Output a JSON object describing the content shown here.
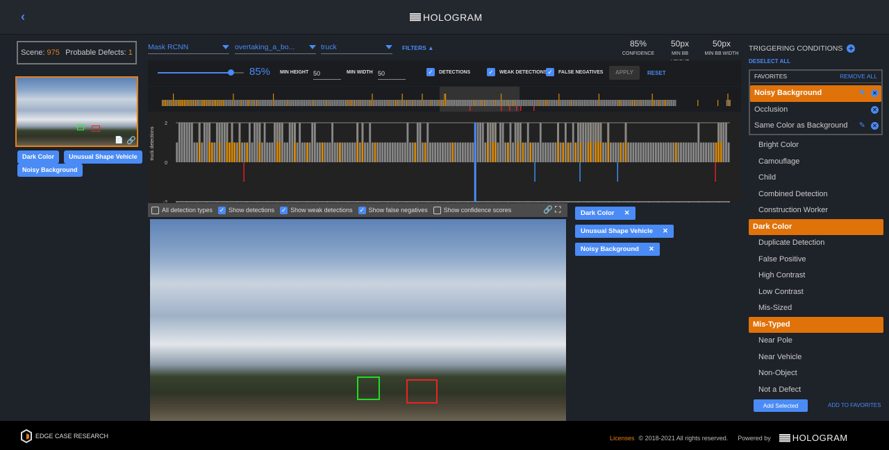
{
  "header": {
    "title": "HOLOGRAM",
    "back_icon": "chevron-left-icon"
  },
  "scene": {
    "label": "Scene:",
    "value": "975",
    "defects_label": "Probable Defects:",
    "defects_value": "1"
  },
  "thumbnail_tags": [
    "Dark Color",
    "Unusual Shape Vehicle",
    "Noisy Background"
  ],
  "dropdowns": {
    "model": "Mask RCNN",
    "scenario": "overtaking_a_bo...",
    "class": "truck",
    "filters_label": "FILTERS"
  },
  "stats": [
    {
      "value": "85%",
      "label": "CONFIDENCE"
    },
    {
      "value": "50px",
      "label": "MIN BB HEIGHT"
    },
    {
      "value": "50px",
      "label": "MIN BB WIDTH"
    }
  ],
  "filters": {
    "confidence_value": "85%",
    "confidence_fraction": 0.85,
    "min_height_label": "MIN HEIGHT",
    "min_height": "50",
    "min_width_label": "MIN WIDTH",
    "min_width": "50",
    "detections": "DETECTIONS",
    "weak": "WEAK DETECTIONS",
    "false_neg": "FALSE NEGATIVES",
    "apply": "APPLY",
    "reset": "RESET"
  },
  "minimap": {
    "range_start": "856",
    "range_end": "1077"
  },
  "chart_data": {
    "type": "bar",
    "ylabel": "truck detections",
    "ylim": [
      -2,
      2
    ],
    "yticks": [
      "2",
      "0",
      "-2"
    ],
    "x_start": 856,
    "x_end": 1076,
    "tick_step": 4,
    "tick_prefix": "s",
    "current_frame": 975,
    "detections": [
      1,
      2,
      2,
      2,
      2,
      2,
      2,
      1,
      1,
      2,
      1,
      2,
      2,
      2,
      1,
      1,
      2,
      2,
      2,
      2,
      2,
      1,
      2,
      1,
      1,
      2,
      1,
      1,
      1,
      2,
      1,
      2,
      2,
      2,
      1,
      2,
      1,
      1,
      1,
      2,
      2,
      2,
      2,
      1,
      1,
      2,
      2,
      2,
      1,
      2,
      1,
      1,
      1,
      1,
      2,
      2,
      1,
      1,
      1,
      1,
      1,
      1,
      2,
      1,
      1,
      1,
      1,
      1,
      1,
      1,
      1,
      1,
      2,
      1,
      2,
      1,
      1,
      2,
      1,
      1,
      1,
      1,
      1,
      1,
      1,
      1,
      1,
      1,
      1,
      1,
      1,
      1,
      2,
      1,
      1,
      1,
      2,
      2,
      1,
      1,
      2,
      1,
      1,
      1,
      1,
      1,
      1,
      1,
      1,
      1,
      1,
      1,
      1,
      1,
      1,
      1,
      1,
      1,
      1,
      1,
      2,
      2,
      2,
      1,
      2,
      2,
      2,
      2,
      1,
      2,
      2,
      1,
      1,
      2,
      1,
      2,
      2,
      2,
      1,
      1,
      2,
      1,
      1,
      1,
      1,
      2,
      1,
      1,
      1,
      1,
      1,
      1,
      2,
      1,
      1,
      2,
      1,
      1,
      2,
      1,
      2,
      2,
      2,
      2,
      2,
      2,
      2,
      2,
      2,
      2,
      1,
      1,
      2,
      1,
      1,
      1,
      1,
      1,
      1,
      2,
      1,
      1,
      1,
      1,
      1,
      1,
      1,
      1,
      1,
      1,
      1,
      1,
      1,
      1,
      1,
      1,
      1,
      1,
      1,
      1,
      1,
      1,
      1,
      1,
      1,
      1,
      1,
      1,
      2,
      1,
      1,
      1,
      1,
      1,
      1,
      1,
      2,
      2,
      2,
      2,
      1
    ],
    "weak_frames": [
      865,
      869,
      870,
      873,
      876,
      877,
      878,
      879,
      881,
      884,
      889,
      896,
      897,
      903,
      908,
      914,
      921,
      928,
      930,
      935,
      951,
      955,
      966,
      980,
      982,
      983,
      988,
      992,
      994,
      997,
      1008,
      1010,
      1012,
      1015,
      1017,
      1020,
      1021,
      1023,
      1024,
      1025,
      1028,
      1033,
      1035,
      1055,
      1071,
      1072,
      1073
    ],
    "false_negative_frames": [
      883,
      1071
    ],
    "weak_false_negative_frames": [
      999,
      1017,
      1032
    ],
    "colors": {
      "detection": "#888888",
      "weak": "#d98b0b",
      "false_negative": "#e02020",
      "weak_false_negative": "#3a8ee8",
      "current": "#4a8bf5"
    }
  },
  "detection_toolbar": [
    {
      "label": "All detection types",
      "checked": false
    },
    {
      "label": "Show detections",
      "checked": true
    },
    {
      "label": "Show weak detections",
      "checked": true
    },
    {
      "label": "Show false negatives",
      "checked": true
    },
    {
      "label": "Show confidence scores",
      "checked": false
    }
  ],
  "chips": [
    "Dark Color",
    "Unusual Shape Vehicle",
    "Noisy Background"
  ],
  "right": {
    "title": "TRIGGERING CONDITIONS",
    "deselect": "DESELECT ALL",
    "favorites_label": "FAVORITES",
    "remove_all": "REMOVE ALL",
    "favorites": [
      {
        "label": "Noisy Background",
        "selected": true,
        "editable": true
      },
      {
        "label": "Occlusion",
        "selected": false,
        "editable": false
      },
      {
        "label": "Same Color as Background",
        "selected": false,
        "editable": true
      }
    ],
    "conditions": [
      {
        "label": "Bright Color"
      },
      {
        "label": "Camouflage"
      },
      {
        "label": "Child"
      },
      {
        "label": "Combined Detection"
      },
      {
        "label": "Construction Worker"
      },
      {
        "label": "Dark Color",
        "selected": true
      },
      {
        "label": "Duplicate Detection"
      },
      {
        "label": "False Positive"
      },
      {
        "label": "High Contrast"
      },
      {
        "label": "Low Contrast"
      },
      {
        "label": "Mis-Sized"
      },
      {
        "label": "Mis-Typed",
        "selected": true
      },
      {
        "label": "Near Pole"
      },
      {
        "label": "Near Vehicle"
      },
      {
        "label": "Non-Object"
      },
      {
        "label": "Not a Defect"
      }
    ],
    "add_selected": "Add Selected",
    "add_favorites": "ADD TO FAVORITES"
  },
  "footer": {
    "brand": "EDGE CASE RESEARCH",
    "licenses": "Licenses",
    "copyright": "© 2018-2021 All rights reserved.",
    "powered": "Powered by",
    "product": "HOLOGRAM"
  },
  "colors": {
    "accent": "#4a8bf5",
    "orange": "#e0720a"
  }
}
